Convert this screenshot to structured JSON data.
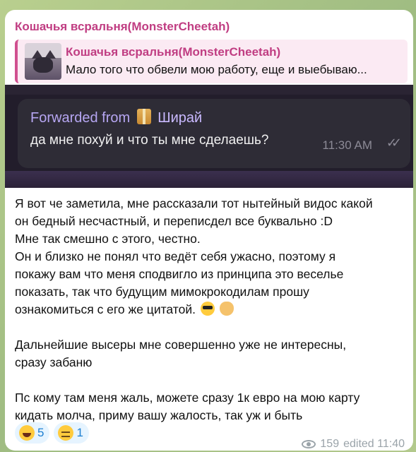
{
  "message": {
    "sender": "Кошачья всральня(MonsterCheetah)",
    "reply": {
      "title": "Кошачья всральня(MonsterCheetah)",
      "text": "Мало того что обвели мою работу, еще и выебываю..."
    },
    "image": {
      "forwarded_prefix": "Forwarded from",
      "forwarded_name": "Ширай",
      "forwarded_text": "да мне похуй и что ты мне сделаешь?",
      "time": "11:30 AM",
      "check": "✓✓"
    },
    "body": [
      "Я вот че заметила, мне рассказали тот нытейный видос какой",
      "он бедный несчастный, и переписдел все буквально :D",
      "Мне так смешно с этого, честно.",
      "Он и близко не понял что ведёт себя ужасно, поэтому я",
      "покажу вам что меня сподвигло из принципа это веселье",
      "показать, так что будущим мимокрокодилам прошу",
      "ознакомиться с его же цитатой.",
      "Дальнейшие высеры мне совершенно уже не интересны,",
      "сразу забаню",
      "Пс кому там меня жаль, можете сразу 1к евро на мою карту",
      "кидать молча, приму вашу жалость, так уж и быть"
    ],
    "reactions": [
      {
        "emoji": "grinning-face",
        "count": "5"
      },
      {
        "emoji": "sleeping-face",
        "count": "1"
      }
    ],
    "views": "159",
    "edited": "edited 11:40"
  }
}
